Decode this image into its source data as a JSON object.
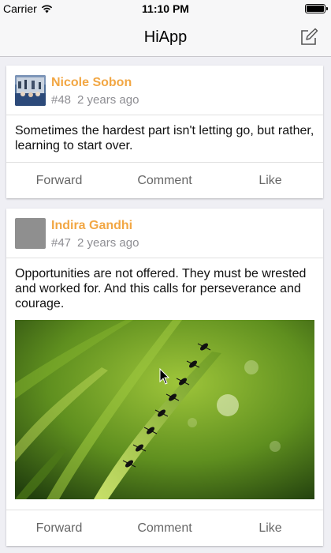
{
  "status_bar": {
    "carrier": "Carrier",
    "time": "11:10 PM",
    "battery_level": 1.0
  },
  "navbar": {
    "title": "HiApp",
    "compose_icon": "compose-icon"
  },
  "posts": [
    {
      "author": "Nicole Sobon",
      "number": "#48",
      "time": "2 years ago",
      "text": "Sometimes the hardest part isn't letting go, but rather, learning to start over.",
      "actions": [
        "Forward",
        "Comment",
        "Like"
      ]
    },
    {
      "author": "Indira Gandhi",
      "number": "#47",
      "time": "2 years ago",
      "text": "Opportunities are not offered. They must be wrested and worked for. And this calls for perseverance and courage.",
      "image": "ants-on-grass-blade",
      "actions": [
        "Forward",
        "Comment",
        "Like"
      ]
    }
  ],
  "colors": {
    "author": "#f2a744",
    "meta": "#8e8e93",
    "action": "#666666",
    "background": "#efeff4",
    "navbar": "#f7f7f8"
  }
}
